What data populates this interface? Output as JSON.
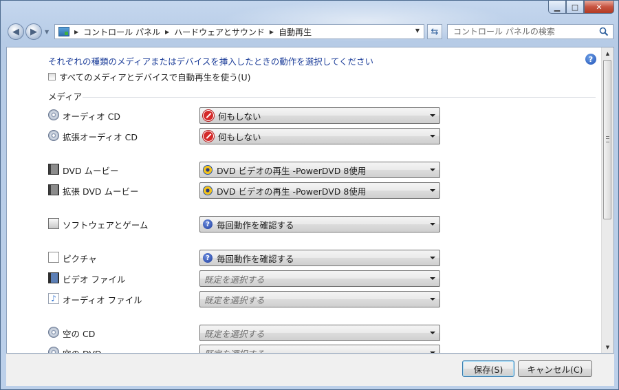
{
  "window": {
    "minimize_icon": "minimize-icon",
    "maximize_icon": "maximize-icon",
    "close_icon": "close-icon"
  },
  "navigation": {
    "back_icon": "back-arrow-icon",
    "forward_icon": "forward-arrow-icon",
    "breadcrumbs": [
      "コントロール パネル",
      "ハードウェアとサウンド",
      "自動再生"
    ],
    "refresh_icon": "refresh-icon",
    "search_placeholder": "コントロール パネルの検索",
    "search_icon": "search-icon"
  },
  "content": {
    "heading": "それぞれの種類のメディアまたはデバイスを挿入したときの動作を選択してください",
    "use_autoplay_label": "すべてのメディアとデバイスで自動再生を使う(U)",
    "use_autoplay_checked": false,
    "section_title": "メディア",
    "rows": [
      {
        "label": "オーディオ CD",
        "icon": "audio-cd-icon",
        "value": "何もしない",
        "value_icon": "do-nothing-icon",
        "placeholder": false
      },
      {
        "label": "拡張オーディオ CD",
        "icon": "enhanced-audio-cd-icon",
        "value": "何もしない",
        "value_icon": "do-nothing-icon",
        "placeholder": false
      },
      {
        "label": "DVD ムービー",
        "icon": "dvd-movie-icon",
        "value": "DVD ビデオの再生 -PowerDVD 8使用",
        "value_icon": "powerdvd-icon",
        "placeholder": false
      },
      {
        "label": "拡張 DVD ムービー",
        "icon": "enhanced-dvd-movie-icon",
        "value": "DVD ビデオの再生 -PowerDVD 8使用",
        "value_icon": "powerdvd-icon",
        "placeholder": false
      },
      {
        "label": "ソフトウェアとゲーム",
        "icon": "software-games-icon",
        "value": "毎回動作を確認する",
        "value_icon": "ask-every-time-icon",
        "placeholder": false
      },
      {
        "label": "ピクチャ",
        "icon": "pictures-icon",
        "value": "毎回動作を確認する",
        "value_icon": "ask-every-time-icon",
        "placeholder": false
      },
      {
        "label": "ビデオ ファイル",
        "icon": "video-files-icon",
        "value": "既定を選択する",
        "value_icon": "",
        "placeholder": true
      },
      {
        "label": "オーディオ ファイル",
        "icon": "audio-files-icon",
        "value": "既定を選択する",
        "value_icon": "",
        "placeholder": true
      },
      {
        "label": "空の CD",
        "icon": "blank-cd-icon",
        "value": "既定を選択する",
        "value_icon": "",
        "placeholder": true
      },
      {
        "label": "空の DVD",
        "icon": "blank-dvd-icon",
        "value": "既定を選択する",
        "value_icon": "",
        "placeholder": true
      }
    ]
  },
  "footer": {
    "save_label": "保存(S)",
    "cancel_label": "キャンセル(C)"
  }
}
